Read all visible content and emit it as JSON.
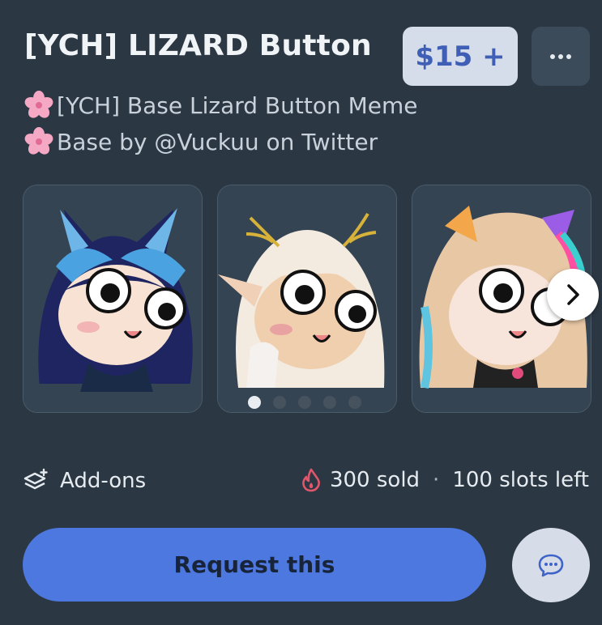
{
  "listing": {
    "title": "[YCH] LIZARD Button",
    "price": "$15 +",
    "more_label": "···",
    "description_lines": [
      "[YCH] Base Lizard Button Meme",
      "Base by @Vuckuu on Twitter"
    ]
  },
  "gallery": {
    "total_pages": 5,
    "active_page": 1
  },
  "footer": {
    "addons_label": "Add-ons",
    "sold_label": "300 sold",
    "separator": "·",
    "slots_label": "100 slots left"
  },
  "actions": {
    "request_label": "Request this"
  },
  "colors": {
    "background": "#2b3743",
    "price_bg": "#d5dcea",
    "price_text": "#3e5fb5",
    "primary_button": "#4d78e0",
    "fire_icon": "#e0566a"
  },
  "icons": [
    "cherry-blossom-icon",
    "more-dots-icon",
    "chevron-right-icon",
    "layers-plus-icon",
    "fire-icon",
    "chat-bubble-icon"
  ]
}
